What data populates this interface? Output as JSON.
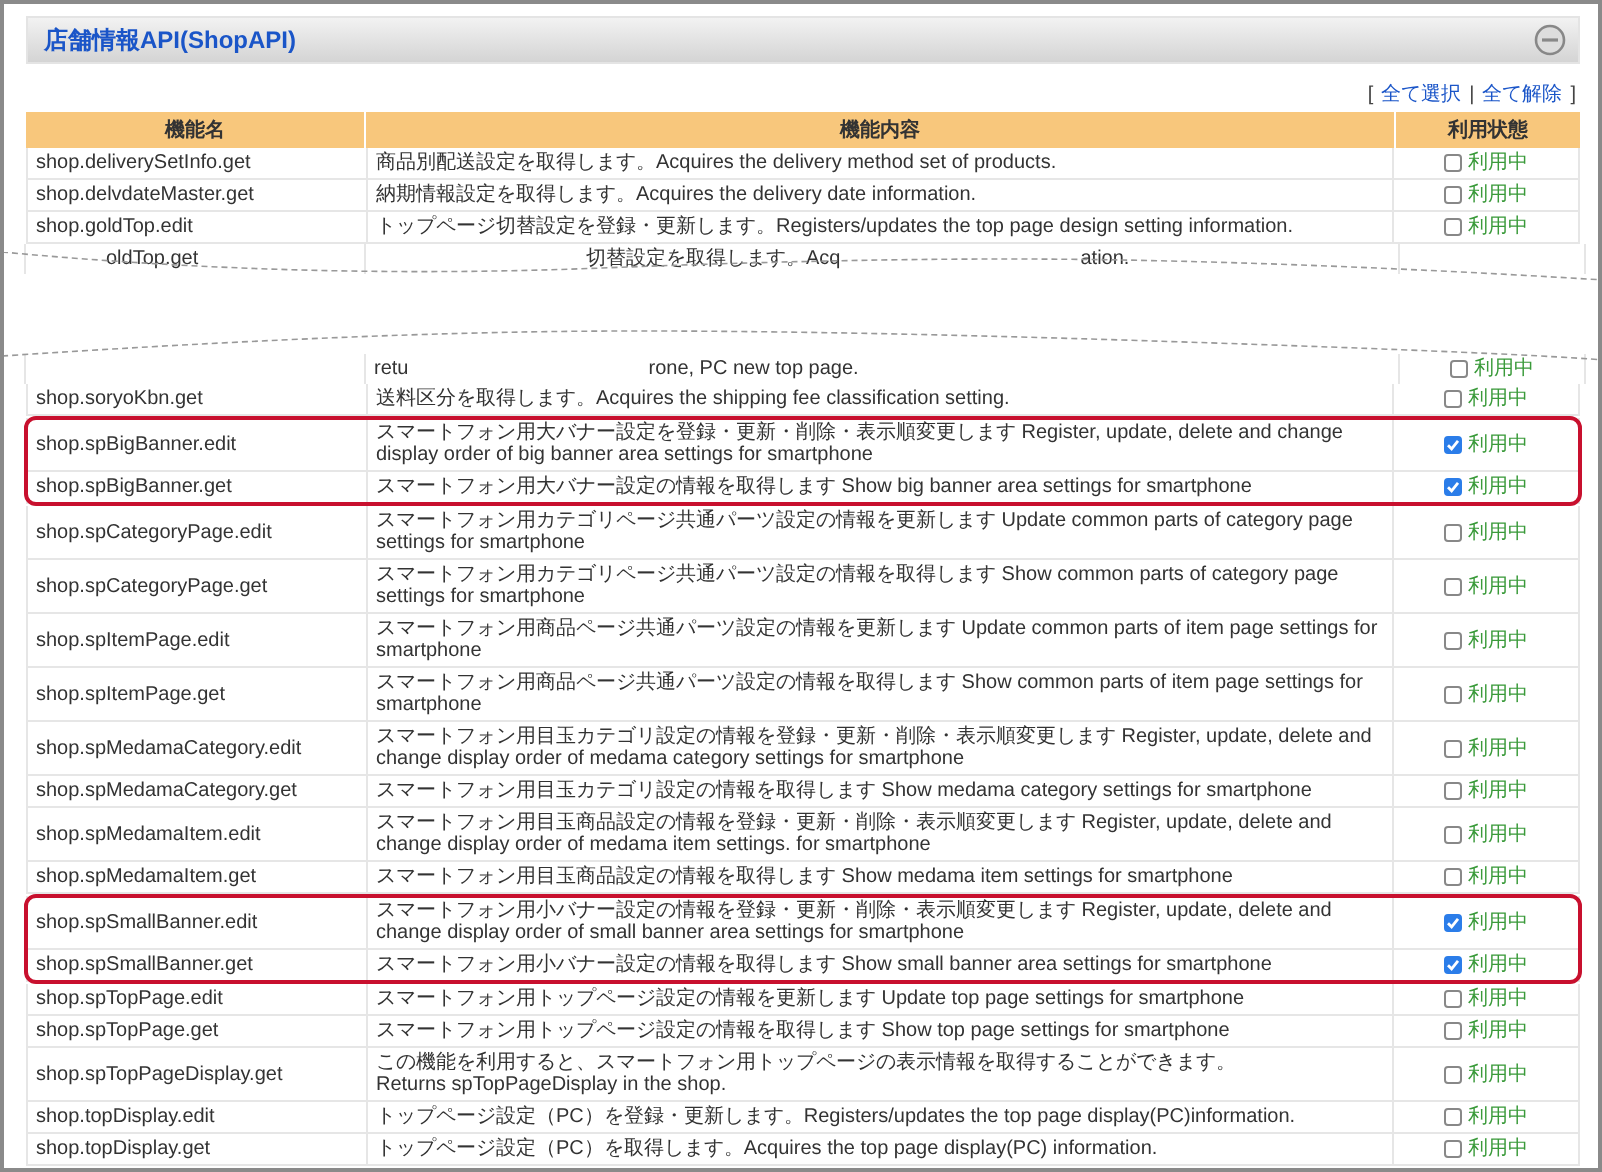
{
  "panel": {
    "title": "店舗情報API(ShopAPI)"
  },
  "select_links": {
    "open": "[",
    "items": [
      "全て選択",
      "全て解除"
    ],
    "separator": "|",
    "close": "]"
  },
  "table": {
    "columns": [
      "機能名",
      "機能内容",
      "利用状態"
    ],
    "rows": [
      {
        "kind": "row",
        "name": "shop.deliverySetInfo.get",
        "description": "商品別配送設定を取得します。Acquires the delivery method set of products.",
        "status": "利用中",
        "checked": false,
        "highlighted": false
      },
      {
        "kind": "row",
        "name": "shop.delvdateMaster.get",
        "description": "納期情報設定を取得します。Acquires the delivery date information.",
        "status": "利用中",
        "checked": false,
        "highlighted": false
      },
      {
        "kind": "row",
        "name": "shop.goldTop.edit",
        "description": "トップページ切替設定を登録・更新します。Registers/updates the top page design setting information.",
        "status": "利用中",
        "checked": false,
        "highlighted": false
      },
      {
        "kind": "fragment_top",
        "name": "oldTop.get",
        "description": "切替設定を取得します。Acq",
        "description_tail": "ation."
      },
      {
        "kind": "fragment_bottom",
        "description": "retu",
        "description_tail": "rone, PC new top page.",
        "status": "利用中",
        "checked": false
      },
      {
        "kind": "row",
        "name": "shop.soryoKbn.get",
        "description": "送料区分を取得します。Acquires the shipping fee classification setting.",
        "status": "利用中",
        "checked": false,
        "highlighted": false
      },
      {
        "kind": "row",
        "name": "shop.spBigBanner.edit",
        "description": "スマートフォン用大バナー設定を登録・更新・削除・表示順変更します Register, update, delete and change display order of big banner area settings for smartphone",
        "status": "利用中",
        "checked": true,
        "highlighted": true
      },
      {
        "kind": "row",
        "name": "shop.spBigBanner.get",
        "description": "スマートフォン用大バナー設定の情報を取得します Show big banner area settings for smartphone",
        "status": "利用中",
        "checked": true,
        "highlighted": true
      },
      {
        "kind": "row",
        "name": "shop.spCategoryPage.edit",
        "description": "スマートフォン用カテゴリページ共通パーツ設定の情報を更新します Update common parts of category page settings for smartphone",
        "status": "利用中",
        "checked": false,
        "highlighted": false
      },
      {
        "kind": "row",
        "name": "shop.spCategoryPage.get",
        "description": "スマートフォン用カテゴリページ共通パーツ設定の情報を取得します Show common parts of category page settings for smartphone",
        "status": "利用中",
        "checked": false,
        "highlighted": false
      },
      {
        "kind": "row",
        "name": "shop.spItemPage.edit",
        "description": "スマートフォン用商品ページ共通パーツ設定の情報を更新します Update common parts of item page settings for smartphone",
        "status": "利用中",
        "checked": false,
        "highlighted": false
      },
      {
        "kind": "row",
        "name": "shop.spItemPage.get",
        "description": "スマートフォン用商品ページ共通パーツ設定の情報を取得します Show common parts of item page settings for smartphone",
        "status": "利用中",
        "checked": false,
        "highlighted": false
      },
      {
        "kind": "row",
        "name": "shop.spMedamaCategory.edit",
        "description": "スマートフォン用目玉カテゴリ設定の情報を登録・更新・削除・表示順変更します Register, update, delete and change display order of medama category settings for smartphone",
        "status": "利用中",
        "checked": false,
        "highlighted": false
      },
      {
        "kind": "row",
        "name": "shop.spMedamaCategory.get",
        "description": "スマートフォン用目玉カテゴリ設定の情報を取得します Show medama category settings for smartphone",
        "status": "利用中",
        "checked": false,
        "highlighted": false
      },
      {
        "kind": "row",
        "name": "shop.spMedamaItem.edit",
        "description": "スマートフォン用目玉商品設定の情報を登録・更新・削除・表示順変更します Register, update, delete and change display order of medama item settings. for smartphone",
        "status": "利用中",
        "checked": false,
        "highlighted": false
      },
      {
        "kind": "row",
        "name": "shop.spMedamaItem.get",
        "description": "スマートフォン用目玉商品設定の情報を取得します Show medama item settings for smartphone",
        "status": "利用中",
        "checked": false,
        "highlighted": false
      },
      {
        "kind": "row",
        "name": "shop.spSmallBanner.edit",
        "description": "スマートフォン用小バナー設定の情報を登録・更新・削除・表示順変更します Register, update, delete and change display order of small banner area settings for smartphone",
        "status": "利用中",
        "checked": true,
        "highlighted": true
      },
      {
        "kind": "row",
        "name": "shop.spSmallBanner.get",
        "description": "スマートフォン用小バナー設定の情報を取得します Show small banner area settings for smartphone",
        "status": "利用中",
        "checked": true,
        "highlighted": true
      },
      {
        "kind": "row",
        "name": "shop.spTopPage.edit",
        "description": "スマートフォン用トップページ設定の情報を更新します Update top page settings for smartphone",
        "status": "利用中",
        "checked": false,
        "highlighted": false
      },
      {
        "kind": "row",
        "name": "shop.spTopPage.get",
        "description": "スマートフォン用トップページ設定の情報を取得します Show top page settings for smartphone",
        "status": "利用中",
        "checked": false,
        "highlighted": false
      },
      {
        "kind": "row",
        "name": "shop.spTopPageDisplay.get",
        "description": "この機能を利用すると、スマートフォン用トップページの表示情報を取得することができます。\nReturns spTopPageDisplay in the shop.",
        "status": "利用中",
        "checked": false,
        "highlighted": false
      },
      {
        "kind": "row",
        "name": "shop.topDisplay.edit",
        "description": "トップページ設定（PC）を登録・更新します。Registers/updates the top page display(PC)information.",
        "status": "利用中",
        "checked": false,
        "highlighted": false
      },
      {
        "kind": "row",
        "name": "shop.topDisplay.get",
        "description": "トップページ設定（PC）を取得します。Acquires the top page display(PC) information.",
        "status": "利用中",
        "checked": false,
        "highlighted": false
      }
    ]
  }
}
